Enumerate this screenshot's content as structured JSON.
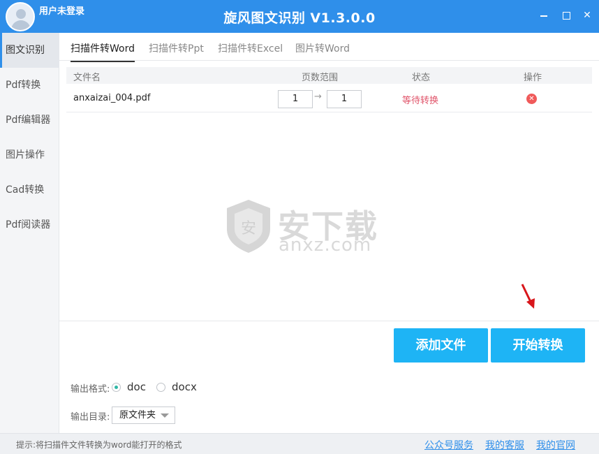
{
  "window": {
    "user_label": "用户未登录",
    "title": "旋风图文识别 V1.3.0.0",
    "close_glyph": "✕"
  },
  "sidebar": {
    "items": [
      {
        "label": "图文识别",
        "active": true
      },
      {
        "label": "Pdf转换"
      },
      {
        "label": "Pdf编辑器"
      },
      {
        "label": "图片操作"
      },
      {
        "label": "Cad转换"
      },
      {
        "label": "Pdf阅读器"
      }
    ]
  },
  "tabs": [
    {
      "label": "扫描件转Word",
      "active": true
    },
    {
      "label": "扫描件转Ppt"
    },
    {
      "label": "扫描件转Excel"
    },
    {
      "label": "图片转Word"
    }
  ],
  "table": {
    "headers": {
      "file": "文件名",
      "range": "页数范围",
      "status": "状态",
      "action": "操作"
    },
    "rows": [
      {
        "file": "anxaizai_004.pdf",
        "page_from": "1",
        "arrow": "→",
        "page_to": "1",
        "status": "等待转换",
        "delete_glyph": "✕"
      }
    ]
  },
  "watermark": {
    "text": "安下载",
    "url": "anxz.com",
    "shield_char": "安"
  },
  "actions": {
    "add_file": "添加文件",
    "start_convert": "开始转换"
  },
  "options": {
    "format_label": "输出格式:",
    "formats": [
      {
        "label": "doc",
        "checked": true
      },
      {
        "label": "docx",
        "checked": false
      }
    ],
    "dir_label": "输出目录:",
    "dir_value": "原文件夹"
  },
  "statusbar": {
    "tip": "提示:将扫描件文件转换为word能打开的格式",
    "links": [
      "公众号服务",
      "我的客服",
      "我的官网"
    ]
  },
  "colors": {
    "titlebar": "#2f8fea",
    "button": "#1eb4f5",
    "status_waiting": "#e0546a",
    "delete": "#f05a5a"
  }
}
